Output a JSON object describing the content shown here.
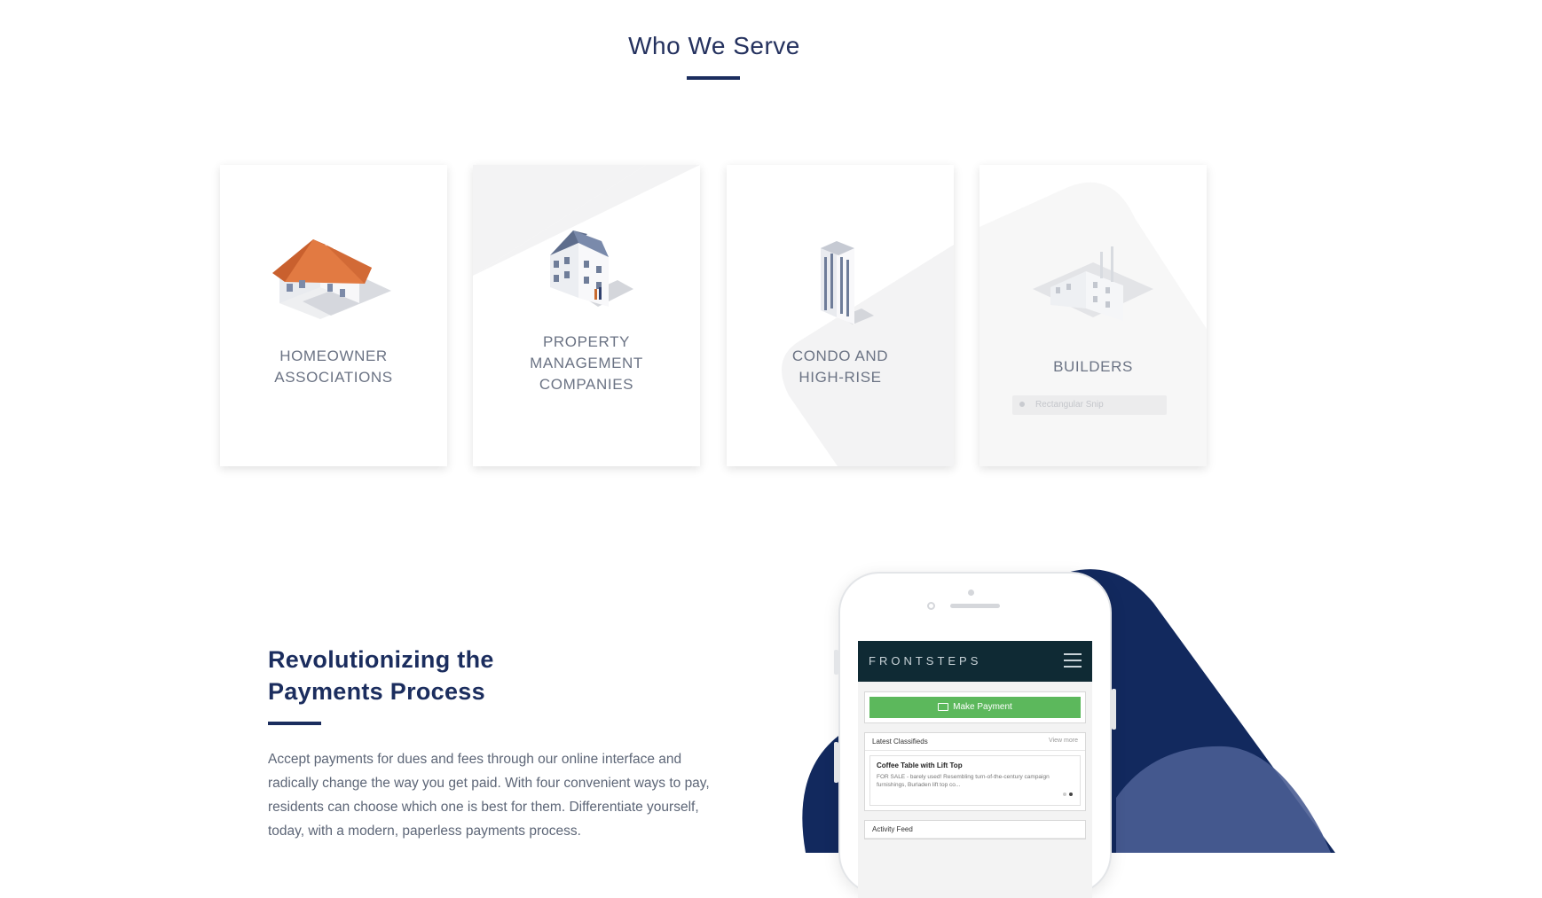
{
  "section": {
    "title": "Who We Serve"
  },
  "cards": [
    {
      "label_line1": "HOMEOWNER",
      "label_line2": "ASSOCIATIONS",
      "label_line3": ""
    },
    {
      "label_line1": "PROPERTY",
      "label_line2": "MANAGEMENT",
      "label_line3": "COMPANIES"
    },
    {
      "label_line1": "CONDO AND",
      "label_line2": "HIGH-RISE",
      "label_line3": ""
    },
    {
      "label_line1": "BUILDERS",
      "label_line2": "",
      "label_line3": ""
    }
  ],
  "snip_label": "Rectangular Snip",
  "payments": {
    "title_line1": "Revolutionizing the",
    "title_line2": "Payments Process",
    "body": "Accept payments for dues and fees through our online interface and radically change the way you get paid. With four convenient ways to pay, residents can choose which one is best for them. Differentiate yourself, today, with a modern, paperless payments process."
  },
  "phone_app": {
    "brand": "FRONTSTEPS",
    "make_payment": "Make Payment",
    "classifieds_header": "Latest Classifieds",
    "view_more": "View more",
    "item_title": "Coffee Table with Lift Top",
    "item_text": "FOR SALE - barely used! Resembling turn-of-the-century campaign furnishings, Burladen lift top co...",
    "activity_header": "Activity Feed"
  },
  "colors": {
    "navy": "#1b2d5e",
    "green": "#5cb85c",
    "app_bar": "#0f2a34"
  }
}
